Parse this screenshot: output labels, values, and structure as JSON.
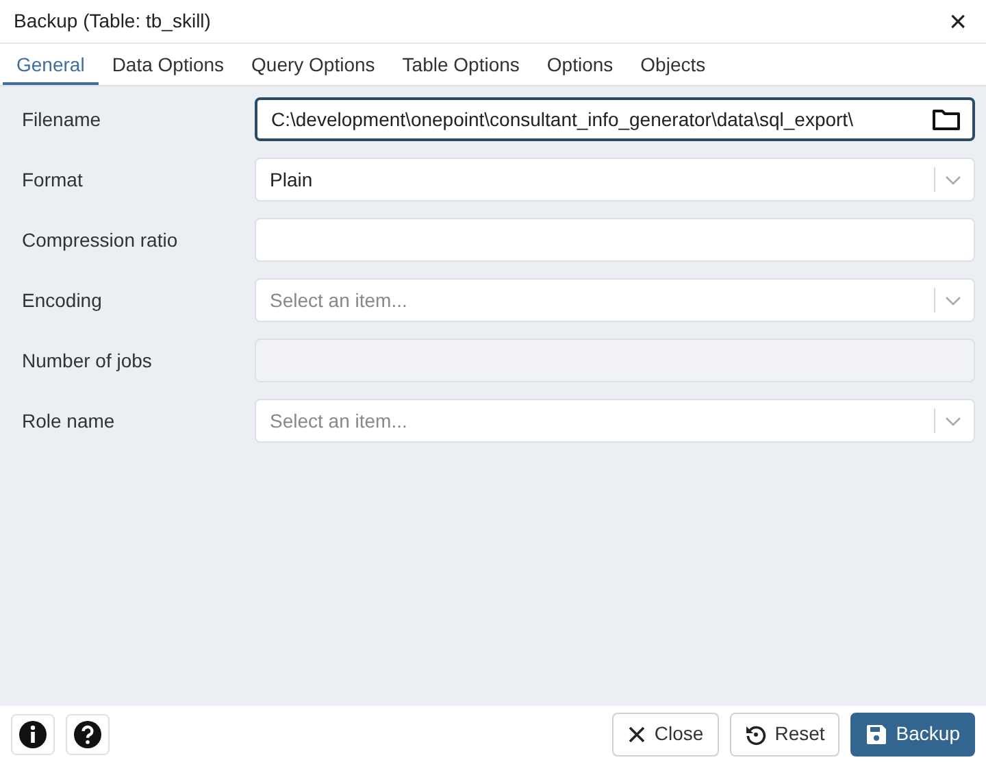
{
  "window": {
    "title": "Backup (Table: tb_skill)",
    "close": "×"
  },
  "tabs": [
    {
      "label": "General",
      "selected": true
    },
    {
      "label": "Data Options",
      "selected": false
    },
    {
      "label": "Query Options",
      "selected": false
    },
    {
      "label": "Table Options",
      "selected": false
    },
    {
      "label": "Options",
      "selected": false
    },
    {
      "label": "Objects",
      "selected": false
    }
  ],
  "fields": [
    {
      "label": "Filename",
      "kind": "file",
      "value": "C:\\development\\onepoint\\consultant_info_generator\\data\\sql_export\\",
      "focused": true
    },
    {
      "label": "Format",
      "kind": "select",
      "value": "Plain"
    },
    {
      "label": "Compression ratio",
      "kind": "text"
    },
    {
      "label": "Encoding",
      "kind": "select",
      "placeholder": "Select an item..."
    },
    {
      "label": "Number of jobs",
      "kind": "text",
      "disabled": true
    },
    {
      "label": "Role name",
      "kind": "select",
      "placeholder": "Select an item..."
    }
  ],
  "footer": {
    "left": [
      {
        "kind": "info"
      },
      {
        "kind": "help"
      }
    ],
    "buttons": [
      {
        "label": "Close",
        "kind": "close",
        "primary": false
      },
      {
        "label": "Reset",
        "kind": "reset",
        "primary": false
      },
      {
        "label": "Backup",
        "kind": "save",
        "primary": true
      }
    ]
  }
}
